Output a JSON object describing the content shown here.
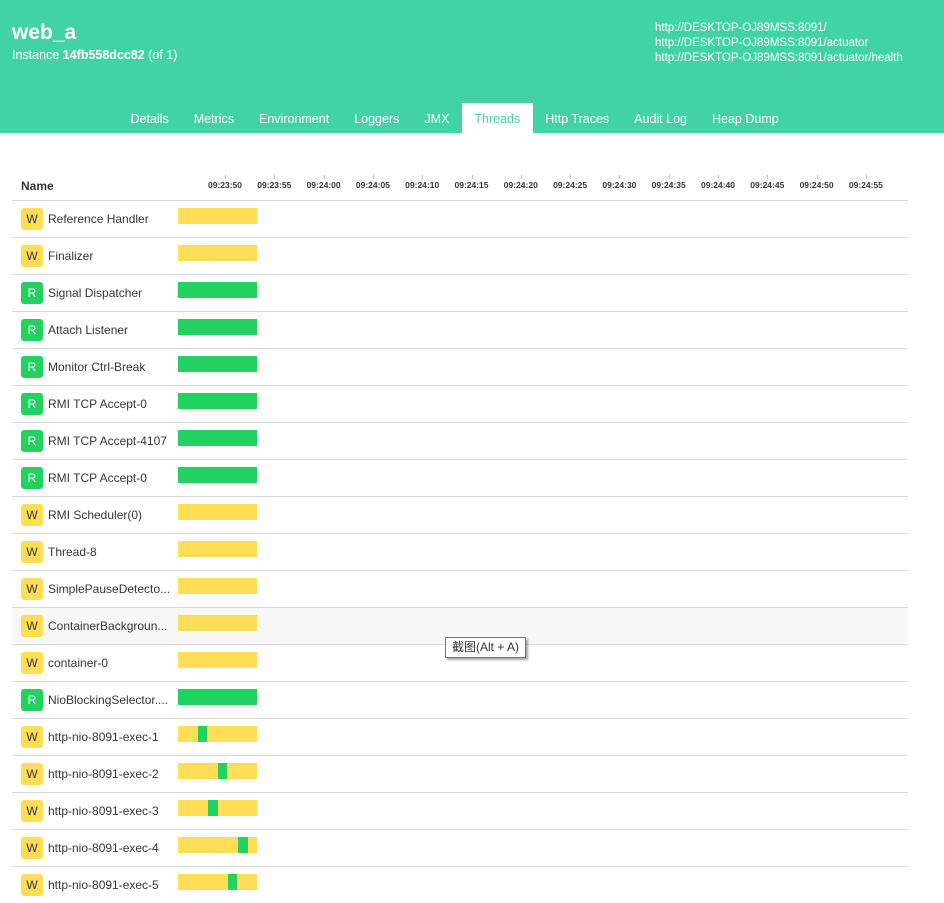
{
  "header": {
    "app_name": "web_a",
    "instance_prefix": "Instance",
    "instance_id": "14fb558dcc82",
    "instance_count": "(of 1)",
    "urls": [
      "http://DESKTOP-OJ89MSS:8091/",
      "http://DESKTOP-OJ89MSS:8091/actuator",
      "http://DESKTOP-OJ89MSS:8091/actuator/health"
    ]
  },
  "tabs": [
    {
      "label": "Details",
      "active": false
    },
    {
      "label": "Metrics",
      "active": false
    },
    {
      "label": "Environment",
      "active": false
    },
    {
      "label": "Loggers",
      "active": false
    },
    {
      "label": "JMX",
      "active": false
    },
    {
      "label": "Threads",
      "active": true
    },
    {
      "label": "Http Traces",
      "active": false
    },
    {
      "label": "Audit Log",
      "active": false
    },
    {
      "label": "Heap Dump",
      "active": false
    }
  ],
  "table": {
    "name_header": "Name",
    "time_ticks": [
      "09:23:50",
      "09:23:55",
      "09:24:00",
      "09:24:05",
      "09:24:10",
      "09:24:15",
      "09:24:20",
      "09:24:25",
      "09:24:30",
      "09:24:35",
      "09:24:40",
      "09:24:45",
      "09:24:50",
      "09:24:55"
    ]
  },
  "colors": {
    "header_bg": "#42d3a5",
    "waiting": "#ffdd57",
    "runnable": "#23d160"
  },
  "threads": [
    {
      "state": "W",
      "name": "Reference Handler",
      "timeline": [
        [
          "W",
          1.0
        ]
      ]
    },
    {
      "state": "W",
      "name": "Finalizer",
      "timeline": [
        [
          "W",
          1.0
        ]
      ]
    },
    {
      "state": "R",
      "name": "Signal Dispatcher",
      "timeline": [
        [
          "R",
          1.0
        ]
      ]
    },
    {
      "state": "R",
      "name": "Attach Listener",
      "timeline": [
        [
          "R",
          1.0
        ]
      ]
    },
    {
      "state": "R",
      "name": "Monitor Ctrl-Break",
      "timeline": [
        [
          "R",
          1.0
        ]
      ]
    },
    {
      "state": "R",
      "name": "RMI TCP Accept-0",
      "timeline": [
        [
          "R",
          1.0
        ]
      ]
    },
    {
      "state": "R",
      "name": "RMI TCP Accept-4107",
      "timeline": [
        [
          "R",
          1.0
        ]
      ]
    },
    {
      "state": "R",
      "name": "RMI TCP Accept-0",
      "timeline": [
        [
          "R",
          1.0
        ]
      ]
    },
    {
      "state": "W",
      "name": "RMI Scheduler(0)",
      "timeline": [
        [
          "W",
          1.0
        ]
      ]
    },
    {
      "state": "W",
      "name": "Thread-8",
      "timeline": [
        [
          "W",
          1.0
        ]
      ]
    },
    {
      "state": "W",
      "name": "SimplePauseDetecto...",
      "timeline": [
        [
          "W",
          1.0
        ]
      ]
    },
    {
      "state": "W",
      "name": "ContainerBackgroun...",
      "timeline": [
        [
          "W",
          1.0
        ]
      ]
    },
    {
      "state": "W",
      "name": "container-0",
      "timeline": [
        [
          "W",
          1.0
        ]
      ]
    },
    {
      "state": "R",
      "name": "NioBlockingSelector....",
      "timeline": [
        [
          "R",
          1.0
        ]
      ]
    },
    {
      "state": "W",
      "name": "http-nio-8091-exec-1",
      "timeline": [
        [
          "W",
          0.25
        ],
        [
          "R",
          0.12
        ],
        [
          "W",
          0.63
        ]
      ]
    },
    {
      "state": "W",
      "name": "http-nio-8091-exec-2",
      "timeline": [
        [
          "W",
          0.5
        ],
        [
          "R",
          0.12
        ],
        [
          "W",
          0.38
        ]
      ]
    },
    {
      "state": "W",
      "name": "http-nio-8091-exec-3",
      "timeline": [
        [
          "W",
          0.38
        ],
        [
          "R",
          0.12
        ],
        [
          "W",
          0.5
        ]
      ]
    },
    {
      "state": "W",
      "name": "http-nio-8091-exec-4",
      "timeline": [
        [
          "W",
          0.76
        ],
        [
          "R",
          0.12
        ],
        [
          "W",
          0.12
        ]
      ]
    },
    {
      "state": "W",
      "name": "http-nio-8091-exec-5",
      "timeline": [
        [
          "W",
          0.63
        ],
        [
          "R",
          0.12
        ],
        [
          "W",
          0.25
        ]
      ]
    }
  ],
  "tooltip": {
    "text": "截图(Alt + A)"
  }
}
